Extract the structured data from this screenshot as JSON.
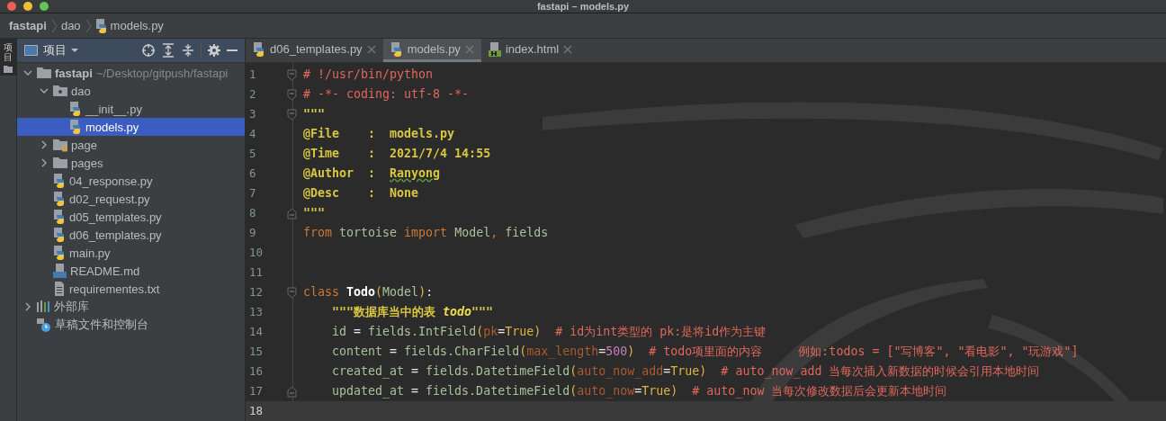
{
  "window": {
    "title": "fastapi – models.py"
  },
  "breadcrumb": [
    {
      "label": "fastapi",
      "kind": "project"
    },
    {
      "label": "dao",
      "kind": "folder"
    },
    {
      "label": "models.py",
      "kind": "python"
    }
  ],
  "side_strip": {
    "tab": "项目"
  },
  "project_panel": {
    "title": "项目",
    "tree": [
      {
        "label": "fastapi",
        "path": "~/Desktop/gitpush/fastapi",
        "kind": "folder",
        "expanded": true,
        "selected": false,
        "children": [
          {
            "label": "dao",
            "kind": "package",
            "expanded": true,
            "selected": false,
            "children": [
              {
                "label": "__init__.py",
                "kind": "python",
                "selected": false
              },
              {
                "label": "models.py",
                "kind": "python",
                "selected": true
              }
            ]
          },
          {
            "label": "page",
            "kind": "folder-special",
            "expanded": false,
            "selected": false
          },
          {
            "label": "pages",
            "kind": "folder",
            "expanded": false,
            "selected": false
          },
          {
            "label": "04_response.py",
            "kind": "python",
            "selected": false
          },
          {
            "label": "d02_request.py",
            "kind": "python",
            "selected": false
          },
          {
            "label": "d05_templates.py",
            "kind": "python",
            "selected": false
          },
          {
            "label": "d06_templates.py",
            "kind": "python",
            "selected": false
          },
          {
            "label": "main.py",
            "kind": "python",
            "selected": false
          },
          {
            "label": "README.md",
            "kind": "markdown",
            "selected": false
          },
          {
            "label": "requirementes.txt",
            "kind": "text",
            "selected": false
          }
        ]
      },
      {
        "label": "外部库",
        "kind": "library",
        "expanded": false,
        "selected": false
      },
      {
        "label": "草稿文件和控制台",
        "kind": "scratch",
        "selected": false
      }
    ]
  },
  "tabs": [
    {
      "label": "d06_templates.py",
      "kind": "python",
      "selected": false
    },
    {
      "label": "models.py",
      "kind": "python",
      "selected": true
    },
    {
      "label": "index.html",
      "kind": "html",
      "selected": false
    }
  ],
  "editor": {
    "lines": [
      {
        "number": "1",
        "fold_open": true,
        "fold_close": false,
        "indented": false,
        "current": false,
        "tokens": [
          {
            "kind": "comment",
            "text": "# !/usr/bin/python"
          }
        ]
      },
      {
        "number": "2",
        "fold_open": true,
        "fold_close": false,
        "indented": false,
        "current": false,
        "tokens": [
          {
            "kind": "comment",
            "text": "# -*- coding: utf-8 -*-"
          }
        ]
      },
      {
        "number": "3",
        "fold_open": true,
        "fold_close": false,
        "indented": false,
        "current": false,
        "tokens": [
          {
            "kind": "doc",
            "text": "\"\"\""
          }
        ]
      },
      {
        "number": "4",
        "fold_open": false,
        "fold_close": false,
        "indented": false,
        "current": false,
        "tokens": [
          {
            "kind": "doc",
            "text": "@File    :  models.py"
          }
        ]
      },
      {
        "number": "5",
        "fold_open": false,
        "fold_close": false,
        "indented": false,
        "current": false,
        "tokens": [
          {
            "kind": "doc",
            "text": "@Time    :  2021/7/4 14:55"
          }
        ]
      },
      {
        "number": "6",
        "fold_open": false,
        "fold_close": false,
        "indented": false,
        "current": false,
        "tokens": [
          {
            "kind": "doc",
            "text": "@Author  :  "
          },
          {
            "kind": "doc-typo",
            "text": "Ranyong"
          }
        ]
      },
      {
        "number": "7",
        "fold_open": false,
        "fold_close": false,
        "indented": false,
        "current": false,
        "tokens": [
          {
            "kind": "doc",
            "text": "@Desc    :  None"
          }
        ]
      },
      {
        "number": "8",
        "fold_open": false,
        "fold_close": true,
        "indented": false,
        "current": false,
        "tokens": [
          {
            "kind": "doc",
            "text": "\"\"\""
          }
        ]
      },
      {
        "number": "9",
        "fold_open": false,
        "fold_close": false,
        "indented": false,
        "current": false,
        "tokens": [
          {
            "kind": "keyword",
            "text": "from"
          },
          {
            "kind": "plain",
            "text": " tortoise "
          },
          {
            "kind": "keyword",
            "text": "import"
          },
          {
            "kind": "plain",
            "text": " Model"
          },
          {
            "kind": "keyword",
            "text": ","
          },
          {
            "kind": "plain",
            "text": " fields"
          }
        ]
      },
      {
        "number": "10",
        "fold_open": false,
        "fold_close": false,
        "current": false
      },
      {
        "number": "11",
        "fold_open": false,
        "fold_close": false,
        "current": false
      },
      {
        "number": "12",
        "fold_open": true,
        "fold_close": false,
        "indented": false,
        "current": false,
        "tokens": [
          {
            "kind": "keyword",
            "text": "class "
          },
          {
            "kind": "classname",
            "text": "Todo"
          },
          {
            "kind": "paren",
            "text": "("
          },
          {
            "kind": "plain",
            "text": "Model"
          },
          {
            "kind": "paren",
            "text": ")"
          },
          {
            "kind": "operator",
            "text": ":"
          }
        ]
      },
      {
        "number": "13",
        "fold_open": false,
        "fold_close": false,
        "indented": true,
        "current": false,
        "tokens": [
          {
            "kind": "doc",
            "text": "\"\"\"数据库当中的表 "
          },
          {
            "kind": "doc-italic",
            "text": "todo"
          },
          {
            "kind": "doc",
            "text": "\"\"\""
          }
        ]
      },
      {
        "number": "14",
        "fold_open": false,
        "fold_close": false,
        "indented": true,
        "current": false,
        "tokens": [
          {
            "kind": "plain",
            "text": "id "
          },
          {
            "kind": "operator",
            "text": "="
          },
          {
            "kind": "plain",
            "text": " fields.IntField"
          },
          {
            "kind": "paren",
            "text": "("
          },
          {
            "kind": "param",
            "text": "pk"
          },
          {
            "kind": "operator",
            "text": "="
          },
          {
            "kind": "builtin",
            "text": "True"
          },
          {
            "kind": "paren",
            "text": ")"
          },
          {
            "kind": "comment",
            "text": "  # id为int类型的 pk:是将id作为主键"
          }
        ]
      },
      {
        "number": "15",
        "fold_open": false,
        "fold_close": false,
        "indented": true,
        "current": false,
        "tokens": [
          {
            "kind": "plain",
            "text": "content "
          },
          {
            "kind": "operator",
            "text": "="
          },
          {
            "kind": "plain",
            "text": " fields.CharField"
          },
          {
            "kind": "paren",
            "text": "("
          },
          {
            "kind": "param",
            "text": "max_length"
          },
          {
            "kind": "operator",
            "text": "="
          },
          {
            "kind": "number",
            "text": "500"
          },
          {
            "kind": "paren",
            "text": ")"
          },
          {
            "kind": "comment",
            "text": "  # todo项里面的内容     例如:todos = [\"写博客\", \"看电影\", \"玩游戏\"]"
          }
        ]
      },
      {
        "number": "16",
        "fold_open": false,
        "fold_close": false,
        "indented": true,
        "current": false,
        "tokens": [
          {
            "kind": "plain",
            "text": "created_at "
          },
          {
            "kind": "operator",
            "text": "="
          },
          {
            "kind": "plain",
            "text": " fields.DatetimeField"
          },
          {
            "kind": "paren",
            "text": "("
          },
          {
            "kind": "param",
            "text": "auto_now_add"
          },
          {
            "kind": "operator",
            "text": "="
          },
          {
            "kind": "builtin",
            "text": "True"
          },
          {
            "kind": "paren",
            "text": ")"
          },
          {
            "kind": "comment",
            "text": "  # auto_now_add 当每次插入新数据的时候会引用本地时间"
          }
        ]
      },
      {
        "number": "17",
        "fold_open": false,
        "fold_close": true,
        "indented": true,
        "current": false,
        "tokens": [
          {
            "kind": "plain",
            "text": "updated_at "
          },
          {
            "kind": "operator",
            "text": "="
          },
          {
            "kind": "plain",
            "text": " fields.DatetimeField"
          },
          {
            "kind": "paren",
            "text": "("
          },
          {
            "kind": "param",
            "text": "auto_now"
          },
          {
            "kind": "operator",
            "text": "="
          },
          {
            "kind": "builtin",
            "text": "True"
          },
          {
            "kind": "paren",
            "text": ")"
          },
          {
            "kind": "comment",
            "text": "  # auto_now 当每次修改数据后会更新本地时间"
          }
        ]
      },
      {
        "number": "18",
        "fold_open": false,
        "fold_close": false,
        "current": true
      }
    ]
  }
}
